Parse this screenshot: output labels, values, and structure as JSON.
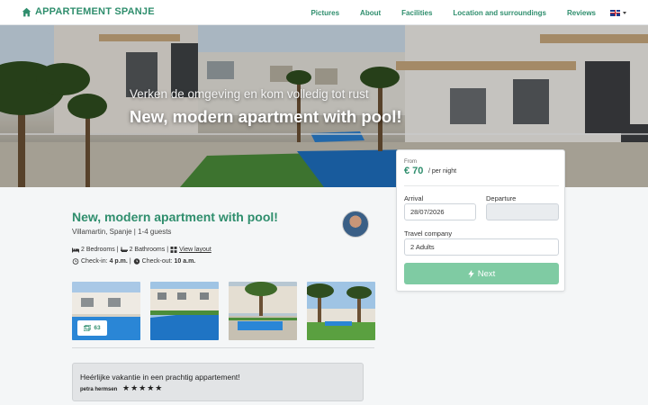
{
  "brand": {
    "name": "APPARTEMENT SPANJE",
    "icon": "home-icon",
    "color": "#2f8e6d"
  },
  "nav": {
    "links": [
      "Pictures",
      "About",
      "Facilities",
      "Location and surroundings",
      "Reviews"
    ],
    "language_icon": "uk-flag-icon"
  },
  "hero": {
    "subtitle": "Verken de omgeving en kom volledig tot rust",
    "title": "New, modern apartment with pool!"
  },
  "booking": {
    "from_label": "From",
    "price": "€ 70",
    "per_night": "/ per night",
    "arrival_label": "Arrival",
    "arrival_value": "28/07/2026",
    "departure_label": "Departure",
    "departure_value": "",
    "company_label": "Travel company",
    "company_value": "2 Adults",
    "next_label": "Next",
    "next_color": "#7fcba3"
  },
  "listing": {
    "title": "New, modern apartment with pool!",
    "location": "Villamartin, Spanje | 1-4 guests",
    "bedrooms": "2 Bedrooms",
    "bathrooms": "2 Bathrooms",
    "layout_link": "View layout",
    "checkin_label": "Check-in:",
    "checkin_value": "4 p.m.",
    "checkout_label": "Check-out:",
    "checkout_value": "10 a.m.",
    "photo_count": "63"
  },
  "review": {
    "text": "Heérlijke vakantie in een prachtig appartement!",
    "author": "petra hermsen",
    "stars": "★★★★★",
    "rating": 5
  }
}
